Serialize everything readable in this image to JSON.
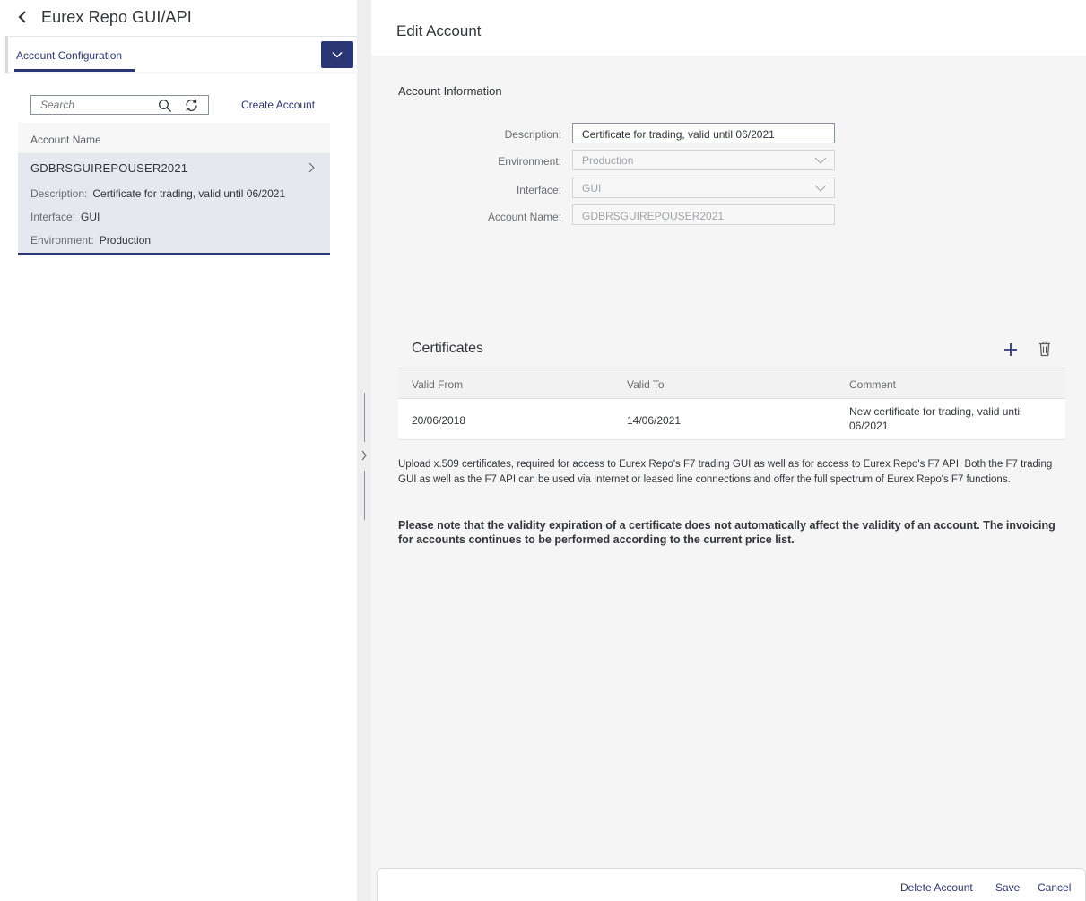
{
  "app": {
    "title": "Eurex Repo GUI/API"
  },
  "left_pane": {
    "config_tab": "Account Configuration",
    "search": {
      "placeholder": "Search",
      "value": ""
    },
    "create_account_label": "Create Account",
    "list_header": "Account Name",
    "items": [
      {
        "name": "GDBRSGUIREPOUSER2021",
        "description_label": "Description:",
        "description_value": "Certificate for trading, valid until 06/2021",
        "interface_label": "Interface:",
        "interface_value": "GUI",
        "environment_label": "Environment:",
        "environment_value": "Production"
      }
    ]
  },
  "right_pane": {
    "title": "Edit Account",
    "account_info": {
      "section_title": "Account Information",
      "description_label": "Description:",
      "description_value": "Certificate for trading, valid until 06/2021",
      "environment_label": "Environment:",
      "environment_value": "Production",
      "interface_label": "Interface:",
      "interface_value": "GUI",
      "account_name_label": "Account Name:",
      "account_name_value": "GDBRSGUIREPOUSER2021"
    },
    "certificates": {
      "title": "Certificates",
      "columns": [
        "Valid From",
        "Valid To",
        "Comment"
      ],
      "rows": [
        {
          "valid_from": "20/06/2018",
          "valid_to": "14/06/2021",
          "comment": "New certificate for trading, valid until 06/2021"
        }
      ]
    },
    "note": "Upload x.509 certificates, required for access to Eurex Repo's F7 trading GUI as well as for access to Eurex Repo's F7 API. Both the F7 trading GUI as well as the F7 API can be used via Internet or leased line connections and offer the full spectrum of Eurex Repo's F7 functions.",
    "note_bold": "Please note that the validity expiration of a certificate does not automatically affect the validity of an account. The invoicing for accounts continues to be performed according to the current price list.",
    "footer": {
      "delete_label": "Delete Account",
      "save_label": "Save",
      "cancel_label": "Cancel"
    }
  },
  "colors": {
    "accent": "#2b3676",
    "selected_row": "#e5e8ee",
    "right_background": "#f5f5f5"
  }
}
